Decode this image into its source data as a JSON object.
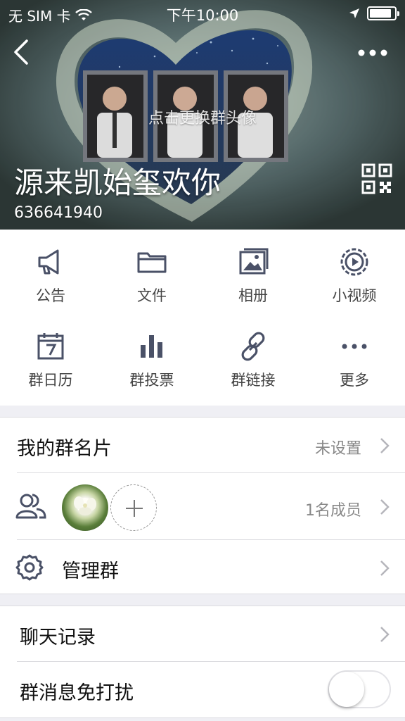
{
  "status_bar": {
    "carrier": "无 SIM 卡",
    "time": "下午10:00"
  },
  "header": {
    "change_avatar_hint": "点击更换群头像",
    "group_name": "源来凯始玺欢你",
    "group_id": "636641940"
  },
  "grid": {
    "items": [
      {
        "label": "公告",
        "icon": "megaphone-icon"
      },
      {
        "label": "文件",
        "icon": "folder-icon"
      },
      {
        "label": "相册",
        "icon": "photo-album-icon"
      },
      {
        "label": "小视频",
        "icon": "video-play-icon"
      },
      {
        "label": "群日历",
        "icon": "calendar-icon"
      },
      {
        "label": "群投票",
        "icon": "bar-chart-icon"
      },
      {
        "label": "群链接",
        "icon": "link-icon"
      },
      {
        "label": "更多",
        "icon": "more-icon"
      }
    ]
  },
  "section1": {
    "card": {
      "title": "我的群名片",
      "value": "未设置"
    },
    "members": {
      "value": "1名成员"
    },
    "manage": {
      "title": "管理群"
    }
  },
  "section2": {
    "chat_history": {
      "title": "聊天记录"
    },
    "mute": {
      "title": "群消息免打扰",
      "enabled": false
    }
  }
}
